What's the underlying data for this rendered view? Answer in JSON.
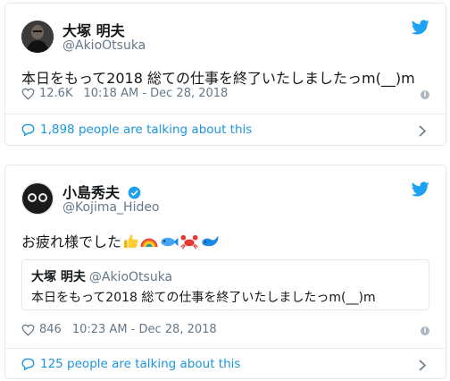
{
  "tweets": [
    {
      "display_name": "大塚 明夫",
      "handle": "@AkioOtsuka",
      "text": "本日をもって2018 総ての仕事を終了いたしましたっm(__)m",
      "likes": "12.6K",
      "timestamp": "10:18 AM - Dec 28, 2018",
      "talking": "1,898 people are talking about this"
    },
    {
      "display_name": "小島秀夫",
      "handle": "@Kojima_Hideo",
      "verified": true,
      "text": "お疲れ様でした",
      "emojis": [
        "thumbs-up",
        "rainbow",
        "fish",
        "crab",
        "whale"
      ],
      "quoted": {
        "display_name": "大塚 明夫",
        "handle": "@AkioOtsuka",
        "text": "本日をもって2018 総ての仕事を終了いたしましたっm(__)m"
      },
      "likes": "846",
      "timestamp": "10:23 AM - Dec 28, 2018",
      "talking": "125 people are talking about this"
    }
  ],
  "colors": {
    "twitter_blue": "#1da1f2",
    "link_blue": "#1b95e0",
    "muted": "#657786",
    "border": "#e1e8ed"
  }
}
